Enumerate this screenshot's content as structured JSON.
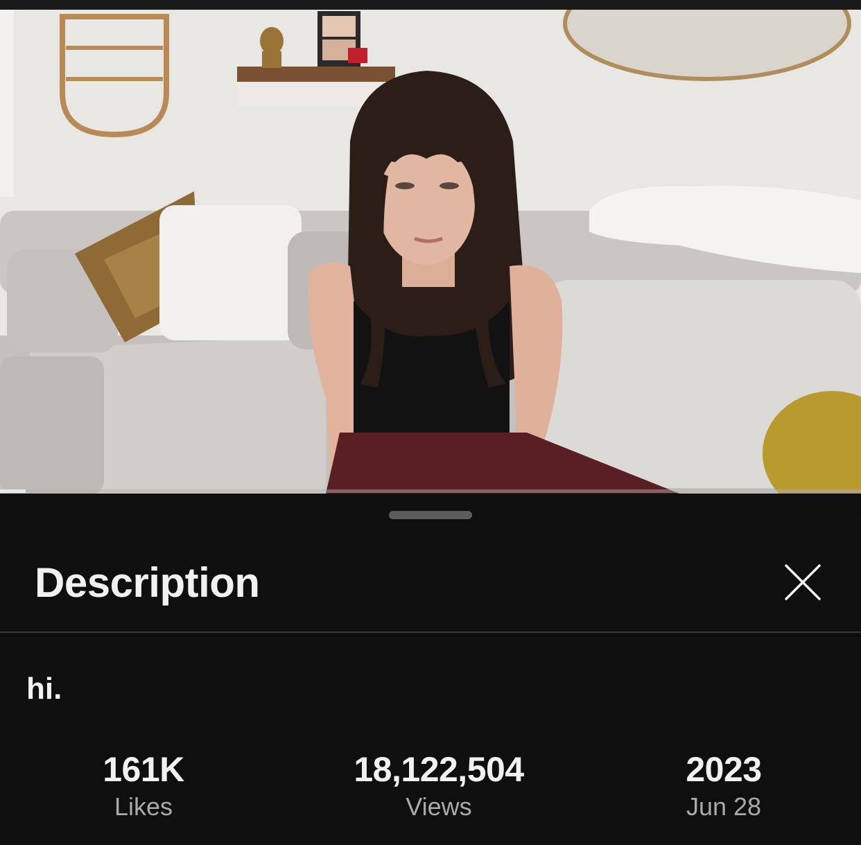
{
  "video": {
    "progress_fraction": 0.03
  },
  "description_sheet": {
    "title": "Description",
    "close_icon": "close-icon",
    "text": "hi.",
    "stats": [
      {
        "value": "161K",
        "label": "Likes"
      },
      {
        "value": "18,122,504",
        "label": "Views"
      },
      {
        "value": "2023",
        "label": "Jun 28"
      }
    ]
  },
  "colors": {
    "background": "#0f0f0f",
    "text_primary": "#f1f1f1",
    "text_secondary": "#aaaaaa",
    "divider": "#3a3a3a"
  }
}
